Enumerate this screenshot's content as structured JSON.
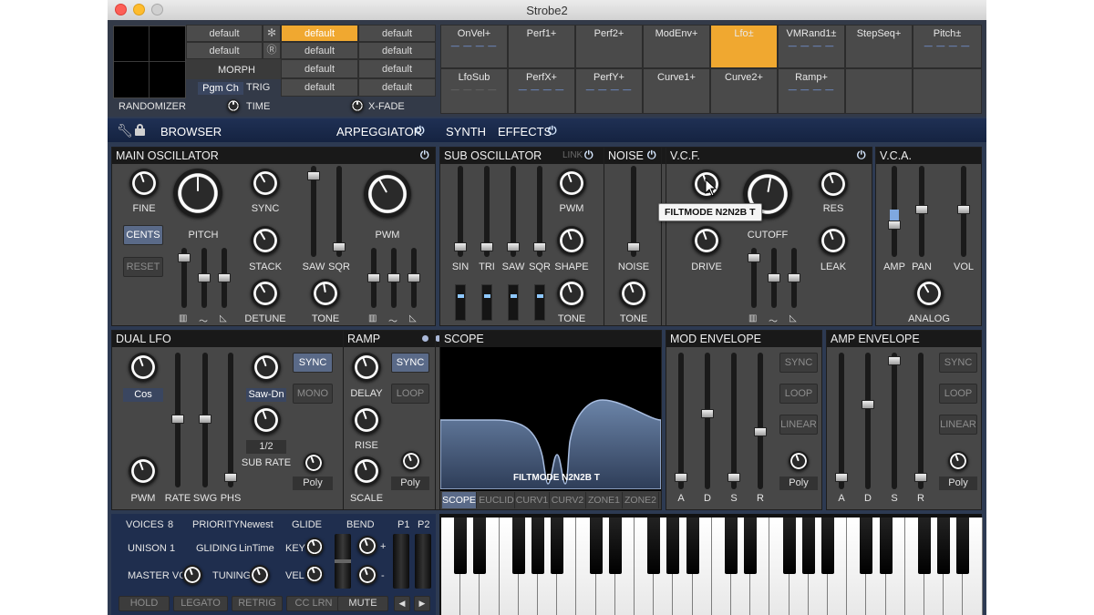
{
  "window": {
    "title": "Strobe2"
  },
  "top": {
    "randomizer": "RANDOMIZER",
    "morph": "MORPH",
    "trig": "TRIG",
    "pgm": "Pgm Ch",
    "time": "TIME",
    "xfade": "X-FADE",
    "snowflake_icon": "snowflake-icon",
    "r_icon": "registered-icon",
    "presets": [
      [
        "default",
        "default",
        "default"
      ],
      [
        "default",
        "default",
        "default"
      ],
      [
        "",
        "default",
        "default"
      ],
      [
        "",
        "default",
        "default"
      ]
    ],
    "active_preset_color": "#f0a830"
  },
  "mod_cells": [
    {
      "label": "OnVel+",
      "dashes": "— — — —",
      "dim": false
    },
    {
      "label": "Perf1+",
      "dashes": "",
      "dim": false
    },
    {
      "label": "Perf2+",
      "dashes": "",
      "dim": false
    },
    {
      "label": "ModEnv+",
      "dashes": "",
      "dim": false
    },
    {
      "label": "Lfo±",
      "dashes": "",
      "dim": false
    },
    {
      "label": "VMRand1±",
      "dashes": "— — — —",
      "dim": false
    },
    {
      "label": "StepSeq+",
      "dashes": "",
      "dim": false
    },
    {
      "label": "Pitch±",
      "dashes": "— — — —",
      "dim": false
    },
    {
      "label": "LfoSub",
      "dashes": "— — — —",
      "dim": true
    },
    {
      "label": "PerfX+",
      "dashes": "— — — —",
      "dim": false
    },
    {
      "label": "PerfY+",
      "dashes": "— — — —",
      "dim": false
    },
    {
      "label": "Curve1+",
      "dashes": "",
      "dim": false
    },
    {
      "label": "Curve2+",
      "dashes": "",
      "dim": false
    },
    {
      "label": "Ramp+",
      "dashes": "— — — —",
      "dim": false
    },
    {
      "label": "",
      "dashes": "",
      "dim": false
    },
    {
      "label": "",
      "dashes": "",
      "dim": false
    }
  ],
  "nav": {
    "wrench_icon": "wrench-icon",
    "lock_icon": "lock-icon",
    "browser": "BROWSER",
    "arpeggiator": "ARPEGGIATOR",
    "synth": "SYNTH",
    "effects": "EFFECTS",
    "power_glyph": "⏻"
  },
  "main_osc": {
    "title": "MAIN OSCILLATOR",
    "fine": "FINE",
    "pitch": "PITCH",
    "sync": "SYNC",
    "stack": "STACK",
    "detune": "DETUNE",
    "saw": "SAW",
    "sqr": "SQR",
    "tone": "TONE",
    "pwm": "PWM",
    "cents": "CENTS",
    "reset": "RESET",
    "keys_glyph": "▥",
    "sine_glyph": "〜",
    "ramp_glyph": "◺"
  },
  "sub_osc": {
    "title": "SUB OSCILLATOR",
    "link": "LINK",
    "sin": "SIN",
    "tri": "TRI",
    "saw": "SAW",
    "sqr": "SQR",
    "pwm": "PWM",
    "shape": "SHAPE",
    "tone": "TONE"
  },
  "noise": {
    "title": "NOISE",
    "noise": "NOISE",
    "tone": "TONE"
  },
  "vcf": {
    "title": "V.C.F.",
    "cutoff": "CUTOFF",
    "res": "RES",
    "drive": "DRIVE",
    "leak": "LEAK",
    "tooltip": "FILTMODE N2N2B T"
  },
  "vca": {
    "title": "V.C.A.",
    "amp": "AMP",
    "pan": "PAN",
    "vol": "VOL",
    "analog": "ANALOG"
  },
  "dual_lfo": {
    "title": "DUAL LFO",
    "wave1": "Cos",
    "wave2": "Saw-Dn",
    "sub_rate_val": "1/2",
    "sync": "SYNC",
    "mono": "MONO",
    "poly": "Poly",
    "pwm": "PWM",
    "rate": "RATE",
    "swg": "SWG",
    "phs": "PHS",
    "sub_rate": "SUB RATE"
  },
  "ramp": {
    "title": "RAMP",
    "delay": "DELAY",
    "rise": "RISE",
    "scale": "SCALE",
    "sync": "SYNC",
    "loop": "LOOP",
    "poly": "Poly"
  },
  "scope": {
    "title": "SCOPE",
    "overlay": "FILTMODE N2N2B T",
    "tabs": [
      "SCOPE",
      "EUCLID",
      "CURV1",
      "CURV2",
      "ZONE1",
      "ZONE2"
    ]
  },
  "mod_env": {
    "title": "MOD ENVELOPE",
    "sync": "SYNC",
    "loop": "LOOP",
    "linear": "LINEAR",
    "poly": "Poly",
    "adsr": [
      "A",
      "D",
      "S",
      "R"
    ]
  },
  "amp_env": {
    "title": "AMP ENVELOPE",
    "sync": "SYNC",
    "loop": "LOOP",
    "linear": "LINEAR",
    "poly": "Poly",
    "adsr": [
      "A",
      "D",
      "S",
      "R"
    ]
  },
  "perf": {
    "voices": "VOICES",
    "voices_val": "8",
    "priority": "PRIORITY",
    "priority_val": "Newest",
    "glide": "GLIDE",
    "unison": "UNISON",
    "unison_val": "1",
    "gliding": "GLIDING",
    "gliding_val": "LinTime",
    "key": "KEY",
    "vel": "VEL",
    "master_vol": "MASTER VOL",
    "tuning": "TUNING",
    "bend": "BEND",
    "p1": "P1",
    "p2": "P2",
    "plus": "+",
    "minus": "-",
    "hold": "HOLD",
    "legato": "LEGATO",
    "retrig": "RETRIG",
    "cc_lrn": "CC LRN",
    "mute": "MUTE",
    "left_arrow": "◀",
    "right_arrow": "▶"
  },
  "colors": {
    "accent": "#f0a830",
    "panel": "#474747",
    "frame": "#2d3a52",
    "highlight": "#5a6a88"
  }
}
